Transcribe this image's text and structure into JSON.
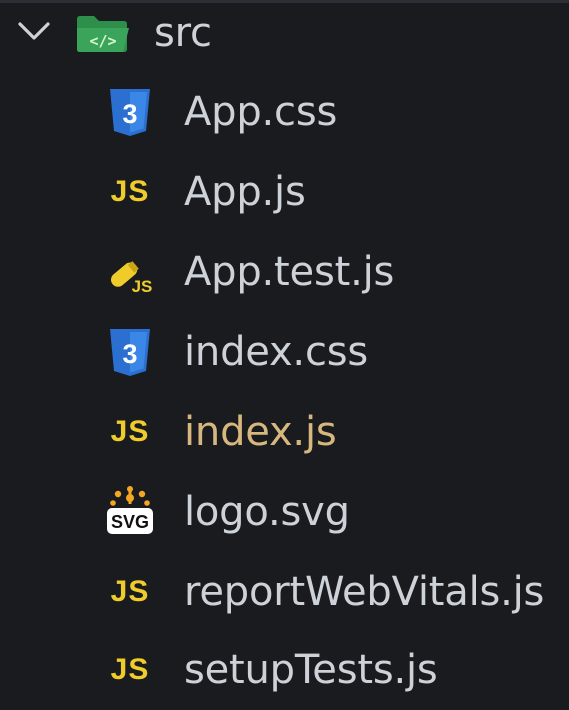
{
  "folder": {
    "name": "src",
    "expanded": true,
    "chevron_icon": "chevron-down-icon",
    "folder_icon": "folder-src-open-icon",
    "folder_color": "#3aa55a"
  },
  "files": [
    {
      "name": "App.css",
      "icon": "css-icon",
      "modified": false
    },
    {
      "name": "App.js",
      "icon": "javascript-icon",
      "modified": false
    },
    {
      "name": "App.test.js",
      "icon": "test-js-icon",
      "modified": false
    },
    {
      "name": "index.css",
      "icon": "css-icon",
      "modified": false
    },
    {
      "name": "index.js",
      "icon": "javascript-icon",
      "modified": true
    },
    {
      "name": "logo.svg",
      "icon": "svg-icon",
      "modified": false
    },
    {
      "name": "reportWebVitals.js",
      "icon": "javascript-icon",
      "modified": false
    },
    {
      "name": "setupTests.js",
      "icon": "javascript-icon",
      "modified": false
    }
  ],
  "icon_labels": {
    "js": "JS",
    "svg": "SVG"
  },
  "colors": {
    "background": "#191b1f",
    "text": "#cdd1d8",
    "modified_text": "#d6b87e",
    "js_yellow": "#f0cc2a",
    "css_blue": "#2b6fd1"
  }
}
